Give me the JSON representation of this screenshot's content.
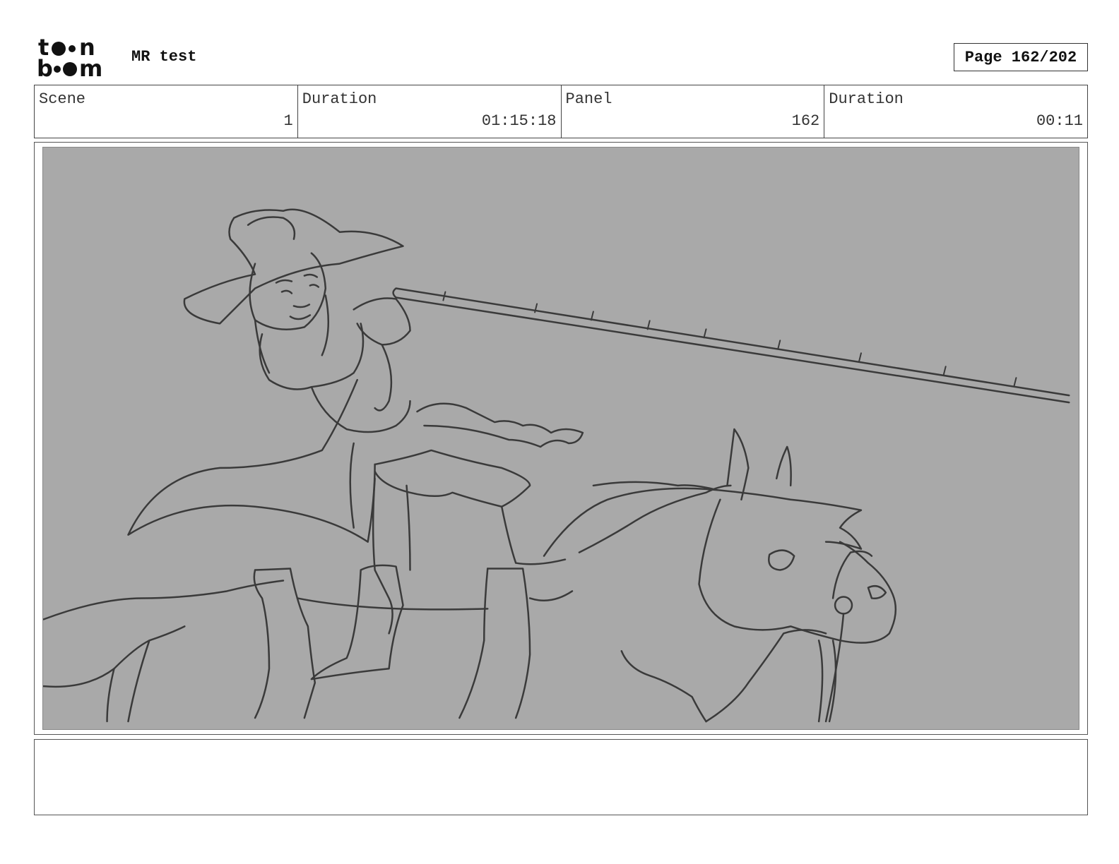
{
  "header": {
    "logo_text": "toon boom",
    "project_title": "MR test",
    "page_label": "Page 162/202"
  },
  "info": {
    "scene_label": "Scene",
    "scene_value": "1",
    "scene_duration_label": "Duration",
    "scene_duration_value": "01:15:18",
    "panel_label": "Panel",
    "panel_value": "162",
    "panel_duration_label": "Duration",
    "panel_duration_value": "00:11"
  },
  "panel": {
    "background_color": "#a9a9a9",
    "line_color": "#3a3a3a"
  },
  "notes": {
    "text": ""
  }
}
